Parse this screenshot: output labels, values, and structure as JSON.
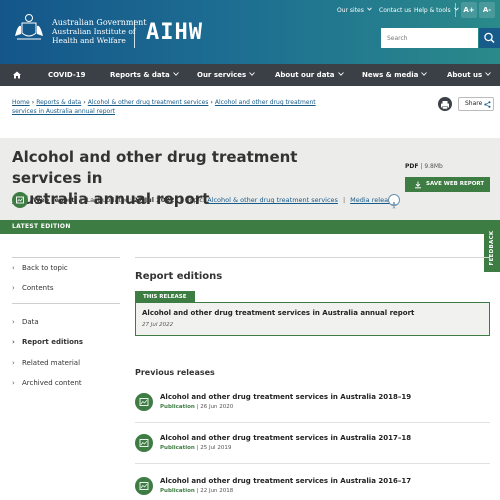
{
  "header": {
    "gov_line1": "Australian Government",
    "gov_line2": "Australian Institute of",
    "gov_line3": "Health and Welfare",
    "logo": "AIHW",
    "util_our_sites": "Our sites",
    "util_contact": "Contact us",
    "util_help": "Help & tools",
    "font_up": "A+",
    "font_down": "A-",
    "search_placeholder": "Search"
  },
  "nav": {
    "items": [
      "COVID-19",
      "Reports & data",
      "Our services",
      "About our data",
      "News & media",
      "About us"
    ]
  },
  "breadcrumb": {
    "items": [
      "Home",
      "Reports & data",
      "Alcohol & other drug treatment services",
      "Alcohol and other drug treatment services in Australia annual report"
    ],
    "share_label": "Share"
  },
  "title_band": {
    "title_line1": "Alcohol and other drug treatment services in",
    "title_line2": "Australia annual report",
    "pdf_label": "PDF",
    "pdf_size": "9.8Mb",
    "save_label": "SAVE WEB REPORT",
    "type_label": "Web report",
    "updated_prefix": "Last updated:",
    "updated_date": "27 Jul 2022",
    "topic_prefix": "Topic:",
    "topic_link": "Alcohol & other drug treatment services",
    "media_link": "Media release"
  },
  "latest": {
    "label": "LATEST EDITION",
    "feedback": "FEEDBACK"
  },
  "sidebar": {
    "items": [
      "Back to topic",
      "Contents",
      "Data",
      "Report editions",
      "Related material",
      "Archived content"
    ]
  },
  "main": {
    "heading": "Report editions",
    "this_release_tag": "THIS RELEASE",
    "this_release_title": "Alcohol and other drug treatment services in Australia annual report",
    "this_release_date": "27 Jul 2022",
    "prev_heading": "Previous releases",
    "prev_releases": [
      {
        "title": "Alcohol and other drug treatment services in Australia 2018–19",
        "type": "Publication",
        "date": "26 Jun 2020"
      },
      {
        "title": "Alcohol and other drug treatment services in Australia 2017–18",
        "type": "Publication",
        "date": "25 Jul 2019"
      },
      {
        "title": "Alcohol and other drug treatment services in Australia 2016–17",
        "type": "Publication",
        "date": "22 Jun 2018"
      }
    ]
  },
  "colors": {
    "header_blue": "#14568a",
    "header_teal": "#2a8a8a",
    "nav_dark": "#3b4047",
    "brand_green": "#3d7c42",
    "link_blue": "#165b8a",
    "band_grey": "#ececea"
  },
  "icons": [
    "coat-of-arms-icon",
    "chevron-down-icon",
    "search-icon",
    "home-icon",
    "print-icon",
    "share-icon",
    "download-icon",
    "report-icon",
    "accessibility-icon",
    "chevron-left-icon",
    "chevron-right-icon"
  ]
}
